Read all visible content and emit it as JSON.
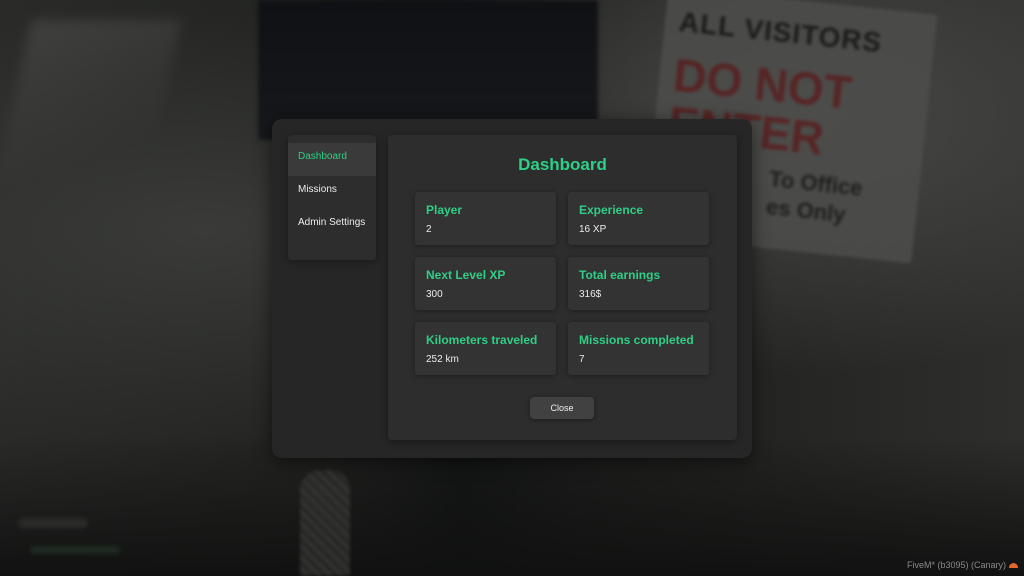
{
  "background_sign": {
    "line1": "ALL VISITORS",
    "line2": "DO NOT",
    "line3": "ENTER",
    "line4": "To Office",
    "line5": "es Only"
  },
  "sidebar": {
    "items": [
      {
        "label": "Dashboard",
        "active": true
      },
      {
        "label": "Missions",
        "active": false
      },
      {
        "label": "Admin Settings",
        "active": false
      }
    ]
  },
  "dashboard": {
    "title": "Dashboard",
    "cards": [
      {
        "label": "Player",
        "value": "2"
      },
      {
        "label": "Experience",
        "value": "16 XP"
      },
      {
        "label": "Next Level XP",
        "value": "300"
      },
      {
        "label": "Total earnings",
        "value": "316$"
      },
      {
        "label": "Kilometers traveled",
        "value": "252 km"
      },
      {
        "label": "Missions completed",
        "value": "7"
      }
    ],
    "close_label": "Close"
  },
  "watermark": {
    "text": "FiveM* (b3095) (Canary)",
    "icon": "fivem-logo-icon"
  },
  "colors": {
    "accent": "#2ecf86",
    "panel": "#252625",
    "card": "#323332"
  }
}
